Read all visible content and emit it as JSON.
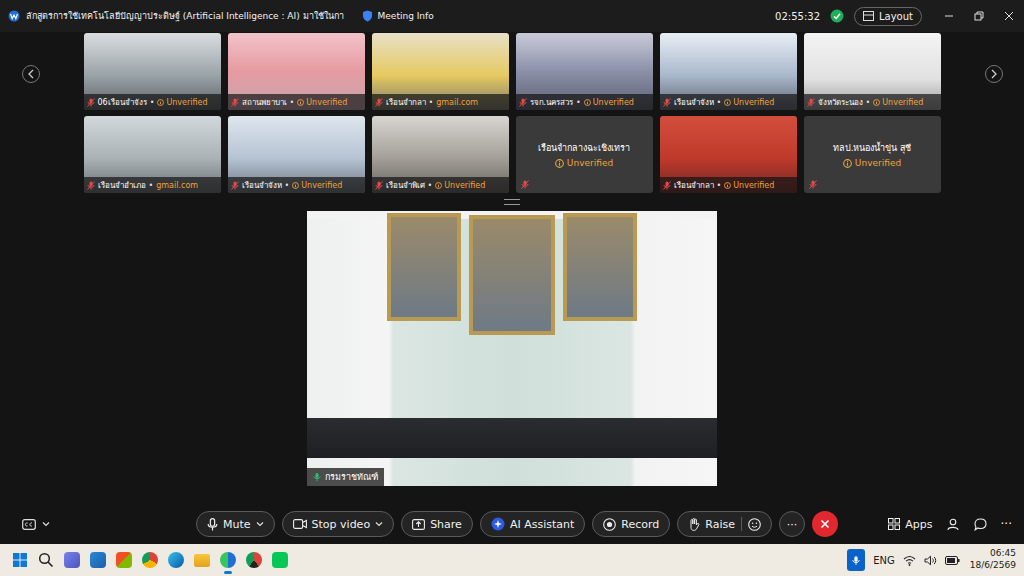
{
  "window": {
    "title": "ลักสูตรการใช้เทคโนโลยีปัญญาประดิษฐ์ (Artificial Intelligence : AI) มาใช้ในกา",
    "meeting_info": "Meeting Info",
    "timer": "02:55:32",
    "layout_button": "Layout"
  },
  "separator": "•",
  "tiles": [
    {
      "name": "06เรือนจำจังร",
      "badge": "Unverified",
      "unverified": true,
      "kind": "video",
      "muted": true
    },
    {
      "name": "สถานพยาบาเ",
      "badge": "Unverified",
      "unverified": true,
      "kind": "video",
      "muted": true
    },
    {
      "name": "เรือนจำกลา",
      "badge": "gmail.com",
      "unverified": false,
      "kind": "video",
      "muted": true
    },
    {
      "name": "รจก.นครสวร",
      "badge": "Unverified",
      "unverified": true,
      "kind": "video",
      "muted": true
    },
    {
      "name": "เรือนจำจังห",
      "badge": "Unverified",
      "unverified": true,
      "kind": "video",
      "muted": true
    },
    {
      "name": "จังหวัดระนอง",
      "badge": "Unverified",
      "unverified": true,
      "kind": "video",
      "muted": true
    },
    {
      "name": "เรือนจำอำเภอ",
      "badge": "gmail.com",
      "unverified": false,
      "kind": "video",
      "muted": true
    },
    {
      "name": "เรือนจำจังห",
      "badge": "Unverified",
      "unverified": true,
      "kind": "video",
      "muted": true
    },
    {
      "name": "เรือนจำพิเศ",
      "badge": "Unverified",
      "unverified": true,
      "kind": "video",
      "muted": true
    },
    {
      "name": "เรือนจำกลางฉะเชิงเทรา",
      "badge": "Unverified",
      "unverified": true,
      "kind": "avatar",
      "muted": true
    },
    {
      "name": "เรือนจำกลา",
      "badge": "Unverified",
      "unverified": true,
      "kind": "video",
      "muted": true
    },
    {
      "name": "ทลป.หนองน้ำขุ่น สุชี",
      "badge": "Unverified",
      "unverified": true,
      "kind": "avatar",
      "muted": true
    }
  ],
  "stage": {
    "name": "กรมราชทัณฑ์",
    "muted": false
  },
  "controls": [
    {
      "label": "Mute",
      "kind": "dropdown"
    },
    {
      "label": "Stop video",
      "kind": "dropdown"
    },
    {
      "label": "Share",
      "kind": "button"
    },
    {
      "label": "AI Assistant",
      "kind": "button"
    },
    {
      "label": "Record",
      "kind": "button"
    },
    {
      "label": "Raise",
      "kind": "reaction"
    },
    {
      "label": "···",
      "kind": "more"
    },
    {
      "label": "",
      "kind": "end"
    }
  ],
  "side_controls": {
    "apps": "Apps",
    "more": "···"
  },
  "taskbar": {
    "language": "ENG",
    "time": "06:45",
    "date": "18/6/2569"
  }
}
